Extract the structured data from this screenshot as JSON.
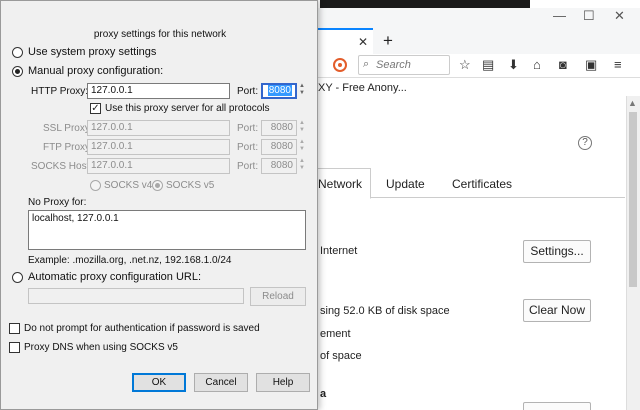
{
  "browser": {
    "window_controls": {
      "minimize": "—",
      "maximize": "☐",
      "close": "✕"
    },
    "tab_close": "✕",
    "new_tab": "+",
    "search_placeholder": "Search",
    "page_title_fragment": "XY - Free Anony...",
    "help_symbol": "?",
    "tabs": {
      "network": "Network",
      "update": "Update",
      "certificates": "Certificates"
    },
    "connection_text": "Internet",
    "settings_button": "Settings...",
    "cache_text": "sing 52.0 KB of disk space",
    "clear_now_button": "Clear Now",
    "management_text": "ement",
    "space_text": "of space",
    "bold_fragment": "a",
    "icons": [
      "star-icon",
      "reading-list-icon",
      "download-icon",
      "home-icon",
      "pocket-save-icon",
      "reader-icon",
      "menu-icon"
    ]
  },
  "dialog": {
    "title": "proxy settings for this network",
    "system_proxy_label": "Use system proxy settings",
    "manual_proxy_label": "Manual proxy configuration:",
    "http_proxy_label": "HTTP Proxy:",
    "http_proxy_value": "127.0.0.1",
    "port_label": "Port:",
    "http_port_value": "8080",
    "use_all_protocols_label": "Use this proxy server for all protocols",
    "ssl_proxy_label": "SSL Proxy:",
    "ssl_proxy_value": "127.0.0.1",
    "ssl_port_value": "8080",
    "ftp_proxy_label": "FTP Proxy:",
    "ftp_proxy_value": "127.0.0.1",
    "ftp_port_value": "8080",
    "socks_host_label": "SOCKS Host:",
    "socks_host_value": "127.0.0.1",
    "socks_port_value": "8080",
    "socks_v4_label": "SOCKS v4",
    "socks_v5_label": "SOCKS v5",
    "no_proxy_label": "No Proxy for:",
    "no_proxy_value": "localhost, 127.0.0.1",
    "example_text": "Example: .mozilla.org, .net.nz, 192.168.1.0/24",
    "auto_proxy_label": "Automatic proxy configuration URL:",
    "auto_proxy_value": "",
    "reload_button": "Reload",
    "no_auth_prompt_label": "Do not prompt for authentication if password is saved",
    "proxy_dns_label": "Proxy DNS when using SOCKS v5",
    "ok_button": "OK",
    "cancel_button": "Cancel",
    "help_button": "Help"
  }
}
